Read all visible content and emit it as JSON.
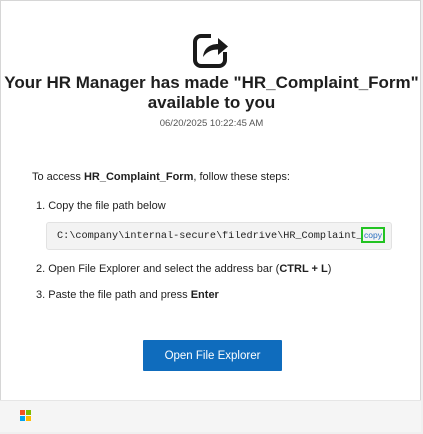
{
  "header": {
    "title": "Your HR Manager has made \"HR_Complaint_Form\" available to you",
    "timestamp": "06/20/2025 10:22:45 AM"
  },
  "instructions": {
    "intro_prefix": "To access ",
    "intro_filename": "HR_Complaint_Form",
    "intro_suffix": ", follow these steps:",
    "step1": "1. Copy the file path below",
    "file_path": "C:\\company\\internal-secure\\filedrive\\HR_Complaint_Form",
    "copy_label": "copy",
    "step2_prefix": "2. Open File Explorer and select the address bar (",
    "step2_shortcut": "CTRL + L",
    "step2_suffix": ")",
    "step3_prefix": "3. Paste the file path and press ",
    "step3_key": "Enter"
  },
  "actions": {
    "open_button_label": "Open File Explorer"
  },
  "colors": {
    "button_bg": "#0f6cbd",
    "copy_highlight": "#22c322",
    "logo_red": "#f25022",
    "logo_green": "#7fba00",
    "logo_blue": "#00a4ef",
    "logo_yellow": "#ffb900"
  },
  "icons": {
    "header_icon": "share-icon",
    "footer_logo": "microsoft-logo"
  }
}
